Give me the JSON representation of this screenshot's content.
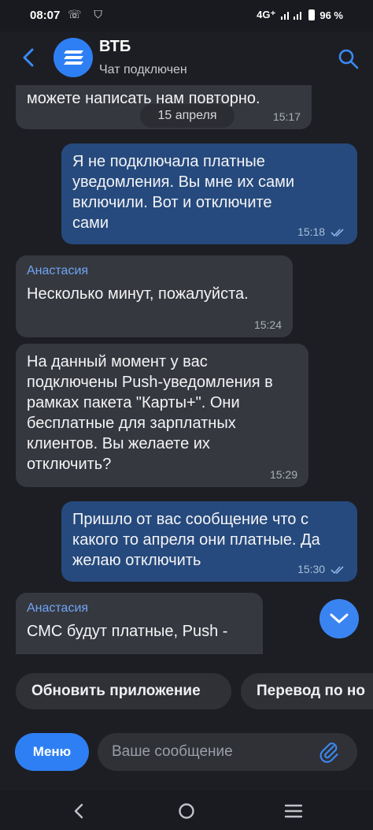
{
  "status_bar": {
    "time": "08:07",
    "left_icons": "☏ ⛉",
    "network": "4G⁺",
    "battery_text": "96 %"
  },
  "header": {
    "title": "ВТБ",
    "subtitle": "Чат подключен"
  },
  "date_chip": "15 апреля",
  "messages": [
    {
      "direction": "in",
      "sender": "",
      "text": "можете написать нам повторно.",
      "time": "15:17"
    },
    {
      "direction": "out",
      "sender": "",
      "text": "Я не подключала платные уведомления. Вы мне их сами включили. Вот и отключите сами",
      "time": "15:18",
      "read": true
    },
    {
      "direction": "in",
      "sender": "Анастасия",
      "text": "Несколько минут, пожалуйста.",
      "time": "15:24"
    },
    {
      "direction": "in",
      "sender": "",
      "text": "На данный момент у вас подключены Push-уведомления в рамках пакета \"Карты+\". Они бесплатные для зарплатных клиентов. Вы желаете их отключить?",
      "time": "15:29"
    },
    {
      "direction": "out",
      "sender": "",
      "text": "Пришло от вас сообщение что с какого то апреля они платные. Да желаю отключить",
      "time": "15:30",
      "read": true
    },
    {
      "direction": "in",
      "sender": "Анастасия",
      "text": "СМС будут платные, Push -",
      "time": ""
    }
  ],
  "suggestions": [
    "Обновить приложение",
    "Перевод по но"
  ],
  "composer": {
    "menu_label": "Меню",
    "placeholder": "Ваше сообщение"
  },
  "colors": {
    "background": "#1d1e23",
    "incoming_bubble": "#36383f",
    "outgoing_bubble": "#264a7d",
    "accent": "#2f7ff4",
    "sender_name": "#6ea5f3"
  },
  "icons": [
    "back-arrow-icon",
    "vtb-logo-icon",
    "search-icon",
    "chevron-down-icon",
    "paperclip-icon",
    "nav-back-icon",
    "nav-home-icon",
    "nav-recents-icon",
    "double-check-icon"
  ]
}
